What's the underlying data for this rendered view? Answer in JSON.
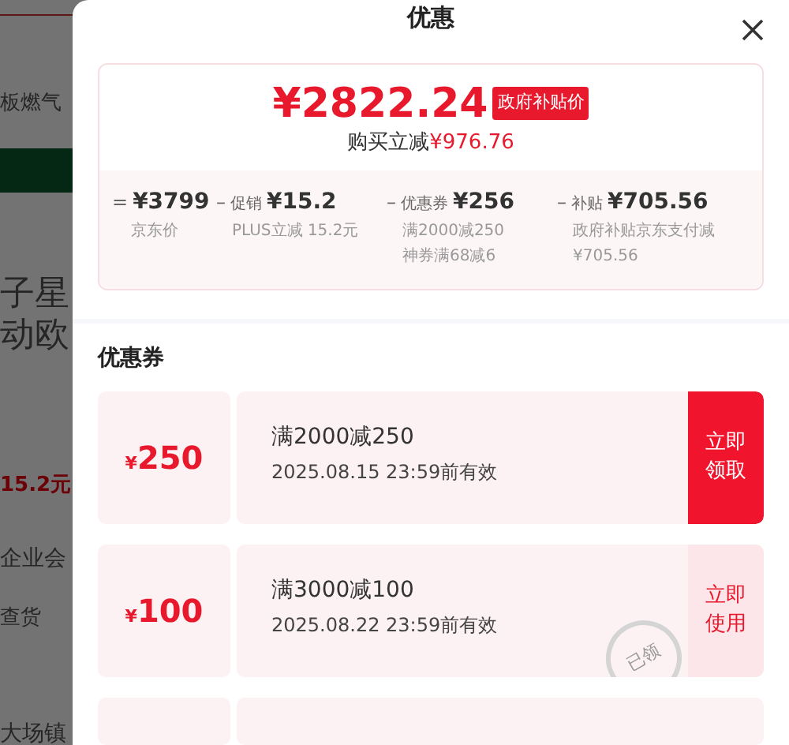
{
  "background_page": {
    "texts": [
      "板燃气",
      "子星",
      "动欧",
      "15.2元",
      "企业会",
      "查货",
      "大场镇"
    ]
  },
  "panel": {
    "title": "优惠"
  },
  "price_card": {
    "price": "¥2822.24",
    "badge": "政府补贴价",
    "saving_label": "购买立减",
    "saving_value": "¥976.76",
    "breakdown": [
      {
        "operator": "=",
        "amount": "¥3799",
        "notes": [
          "京东价"
        ]
      },
      {
        "operator": "–",
        "label": "促销",
        "amount": "¥15.2",
        "notes": [
          "PLUS立减 15.2元"
        ]
      },
      {
        "operator": "–",
        "label": "优惠券",
        "amount": "¥256",
        "notes": [
          "满2000减250",
          "神券满68减6"
        ]
      },
      {
        "operator": "–",
        "label": "补贴",
        "amount": "¥705.56",
        "notes": [
          "政府补贴京东支付减¥705.56"
        ]
      }
    ]
  },
  "coupons": {
    "heading": "优惠券",
    "items": [
      {
        "currency": "¥",
        "amount": "250",
        "condition": "满2000减250",
        "validity": "2025.08.15 23:59前有效",
        "action": "立即领取",
        "claimed": false
      },
      {
        "currency": "¥",
        "amount": "100",
        "condition": "满3000减100",
        "validity": "2025.08.22 23:59前有效",
        "action": "立即使用",
        "claimed": true,
        "stamp": "已领"
      }
    ]
  }
}
